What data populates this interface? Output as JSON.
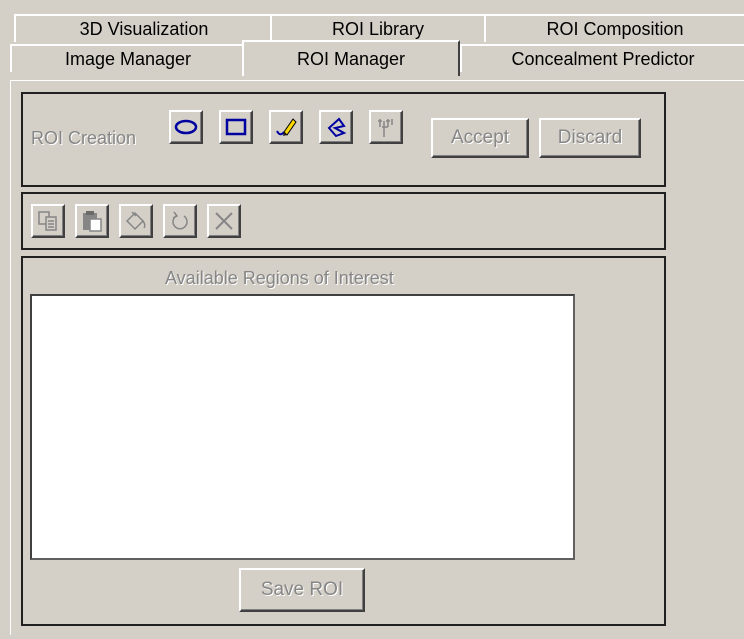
{
  "tabs_back": [
    "3D Visualization",
    "ROI Library",
    "ROI Composition"
  ],
  "tabs_front": [
    "Image Manager",
    "ROI Manager",
    "Concealment Predictor"
  ],
  "active_tab": "ROI Manager",
  "roi_creation": {
    "label": "ROI Creation",
    "tools": [
      "ellipse-icon",
      "rectangle-icon",
      "freehand-pencil-icon",
      "polygon-icon",
      "magic-wand-icon"
    ],
    "accept_label": "Accept",
    "discard_label": "Discard"
  },
  "edit_toolbar": {
    "tools": [
      "copy-icon",
      "paste-icon",
      "fill-bucket-icon",
      "undo-icon",
      "delete-icon"
    ]
  },
  "regions": {
    "title": "Available Regions of Interest",
    "items": [],
    "save_label": "Save ROI"
  },
  "colors": {
    "face": "#d4d0c8",
    "disabled_text": "#868686",
    "icon_blue": "#0000a0",
    "pencil_yellow": "#ffd800"
  }
}
